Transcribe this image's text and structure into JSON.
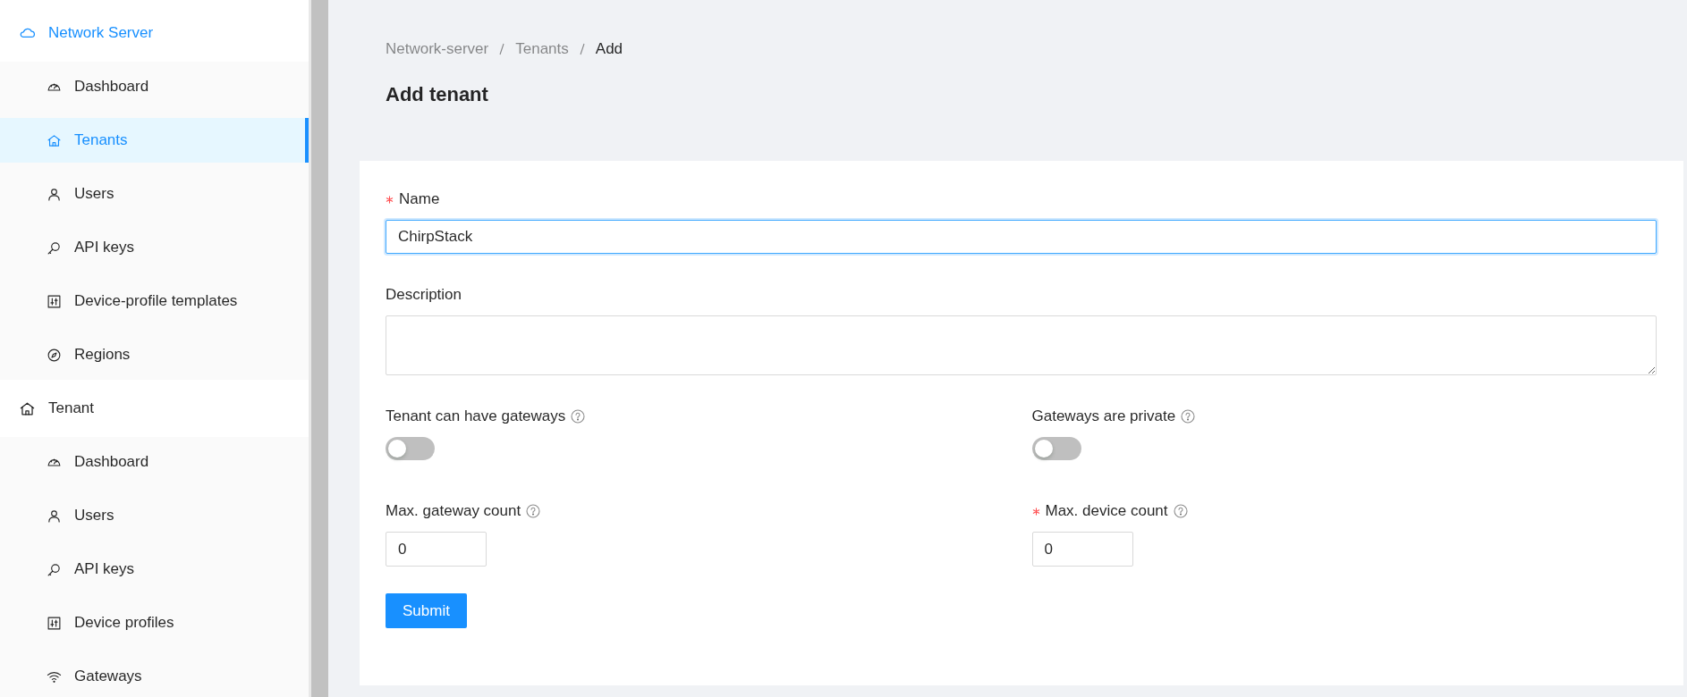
{
  "sidebar": {
    "groups": [
      {
        "title": "Network Server",
        "kind": "cloud",
        "items": [
          {
            "label": "Dashboard",
            "kind": "dashboard",
            "selected": false
          },
          {
            "label": "Tenants",
            "kind": "home",
            "selected": true
          },
          {
            "label": "Users",
            "kind": "user",
            "selected": false
          },
          {
            "label": "API keys",
            "kind": "key",
            "selected": false
          },
          {
            "label": "Device-profile templates",
            "kind": "sliders",
            "selected": false
          },
          {
            "label": "Regions",
            "kind": "compass",
            "selected": false
          }
        ]
      },
      {
        "title": "Tenant",
        "kind": "home",
        "items": [
          {
            "label": "Dashboard",
            "kind": "dashboard",
            "selected": false
          },
          {
            "label": "Users",
            "kind": "user",
            "selected": false
          },
          {
            "label": "API keys",
            "kind": "key",
            "selected": false
          },
          {
            "label": "Device profiles",
            "kind": "sliders",
            "selected": false
          },
          {
            "label": "Gateways",
            "kind": "wifi",
            "selected": false
          }
        ]
      }
    ]
  },
  "breadcrumb": [
    "Network-server",
    "Tenants",
    "Add"
  ],
  "title": "Add tenant",
  "form": {
    "fields": [
      {
        "kind": "text",
        "label": "Name",
        "required": true,
        "value": "ChirpStack",
        "focused": true
      },
      {
        "kind": "textarea",
        "label": "Description",
        "required": false,
        "focused": false
      }
    ],
    "grid": [
      {
        "kind": "switch",
        "label": "Tenant can have gateways",
        "required": false,
        "help": true,
        "on": false
      },
      {
        "kind": "switch",
        "label": "Gateways are private",
        "required": false,
        "help": true,
        "on": false
      },
      {
        "kind": "number",
        "label": "Max. gateway count",
        "required": false,
        "help": true,
        "value": "0"
      },
      {
        "kind": "number",
        "label": "Max. device count",
        "required": true,
        "help": true,
        "value": "0"
      }
    ],
    "submit": "Submit"
  }
}
